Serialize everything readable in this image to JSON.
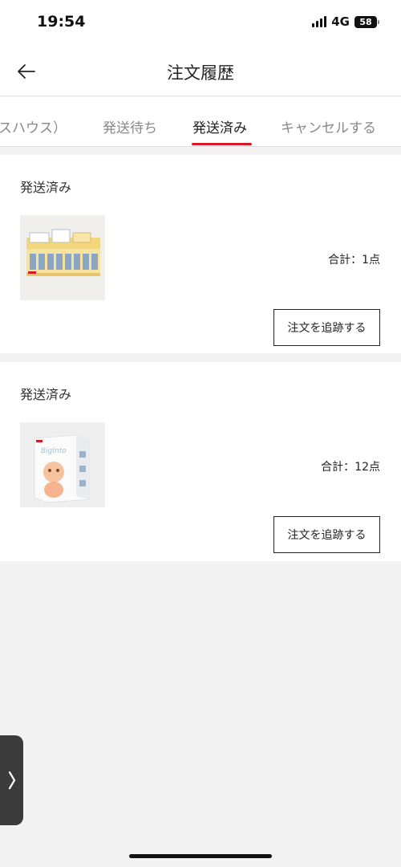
{
  "status_bar": {
    "time": "19:54",
    "network": "4G",
    "battery": "58"
  },
  "header": {
    "back_icon": "arrow-left-icon",
    "title": "注文履歴"
  },
  "tabs": [
    {
      "label": "スハウス）",
      "active": false
    },
    {
      "label": "発送待ち",
      "active": false
    },
    {
      "label": "発送済み",
      "active": true
    },
    {
      "label": "キャンセルする",
      "active": false
    }
  ],
  "orders": [
    {
      "status": "発送済み",
      "total": "合計：1点",
      "track_label": "注文を追跡する",
      "thumbnail": "blind-box-set-image"
    },
    {
      "status": "発送済み",
      "total": "合計：12点",
      "track_label": "注文を追跡する",
      "thumbnail": "figure-box-image"
    }
  ],
  "colors": {
    "accent": "#d7192b",
    "background": "#f3f3f3"
  }
}
